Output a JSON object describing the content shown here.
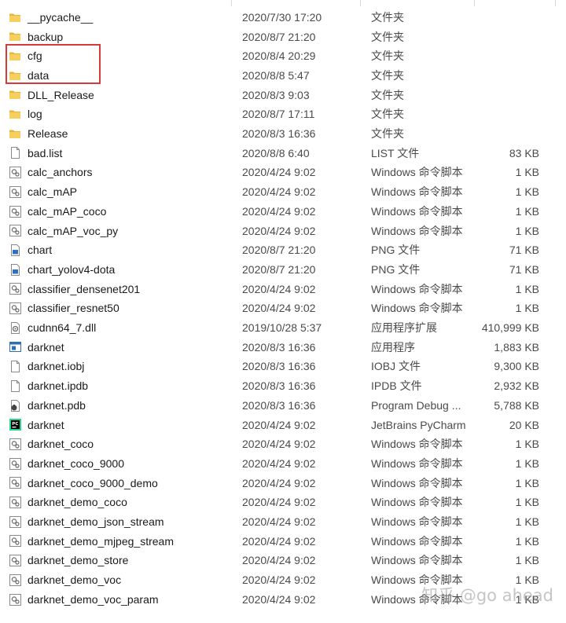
{
  "files": [
    {
      "name": "__pycache__",
      "date": "2020/7/30 17:20",
      "type": "文件夹",
      "size": "",
      "icon": "folder-icon"
    },
    {
      "name": "backup",
      "date": "2020/8/7 21:20",
      "type": "文件夹",
      "size": "",
      "icon": "folder-icon"
    },
    {
      "name": "cfg",
      "date": "2020/8/4 20:29",
      "type": "文件夹",
      "size": "",
      "icon": "folder-icon"
    },
    {
      "name": "data",
      "date": "2020/8/8 5:47",
      "type": "文件夹",
      "size": "",
      "icon": "folder-icon"
    },
    {
      "name": "DLL_Release",
      "date": "2020/8/3 9:03",
      "type": "文件夹",
      "size": "",
      "icon": "folder-icon"
    },
    {
      "name": "log",
      "date": "2020/8/7 17:11",
      "type": "文件夹",
      "size": "",
      "icon": "folder-icon"
    },
    {
      "name": "Release",
      "date": "2020/8/3 16:36",
      "type": "文件夹",
      "size": "",
      "icon": "folder-icon"
    },
    {
      "name": "bad.list",
      "date": "2020/8/8 6:40",
      "type": "LIST 文件",
      "size": "83 KB",
      "icon": "file-icon"
    },
    {
      "name": "calc_anchors",
      "date": "2020/4/24 9:02",
      "type": "Windows 命令脚本",
      "size": "1 KB",
      "icon": "script-icon"
    },
    {
      "name": "calc_mAP",
      "date": "2020/4/24 9:02",
      "type": "Windows 命令脚本",
      "size": "1 KB",
      "icon": "script-icon"
    },
    {
      "name": "calc_mAP_coco",
      "date": "2020/4/24 9:02",
      "type": "Windows 命令脚本",
      "size": "1 KB",
      "icon": "script-icon"
    },
    {
      "name": "calc_mAP_voc_py",
      "date": "2020/4/24 9:02",
      "type": "Windows 命令脚本",
      "size": "1 KB",
      "icon": "script-icon"
    },
    {
      "name": "chart",
      "date": "2020/8/7 21:20",
      "type": "PNG 文件",
      "size": "71 KB",
      "icon": "image-icon"
    },
    {
      "name": "chart_yolov4-dota",
      "date": "2020/8/7 21:20",
      "type": "PNG 文件",
      "size": "71 KB",
      "icon": "image-icon"
    },
    {
      "name": "classifier_densenet201",
      "date": "2020/4/24 9:02",
      "type": "Windows 命令脚本",
      "size": "1 KB",
      "icon": "script-icon"
    },
    {
      "name": "classifier_resnet50",
      "date": "2020/4/24 9:02",
      "type": "Windows 命令脚本",
      "size": "1 KB",
      "icon": "script-icon"
    },
    {
      "name": "cudnn64_7.dll",
      "date": "2019/10/28 5:37",
      "type": "应用程序扩展",
      "size": "410,999 KB",
      "icon": "dll-icon"
    },
    {
      "name": "darknet",
      "date": "2020/8/3 16:36",
      "type": "应用程序",
      "size": "1,883 KB",
      "icon": "exe-icon"
    },
    {
      "name": "darknet.iobj",
      "date": "2020/8/3 16:36",
      "type": "IOBJ 文件",
      "size": "9,300 KB",
      "icon": "file-icon"
    },
    {
      "name": "darknet.ipdb",
      "date": "2020/8/3 16:36",
      "type": "IPDB 文件",
      "size": "2,932 KB",
      "icon": "file-icon"
    },
    {
      "name": "darknet.pdb",
      "date": "2020/8/3 16:36",
      "type": "Program Debug ...",
      "size": "5,788 KB",
      "icon": "pdb-icon"
    },
    {
      "name": "darknet",
      "date": "2020/4/24 9:02",
      "type": "JetBrains PyCharm",
      "size": "20 KB",
      "icon": "pycharm-icon"
    },
    {
      "name": "darknet_coco",
      "date": "2020/4/24 9:02",
      "type": "Windows 命令脚本",
      "size": "1 KB",
      "icon": "script-icon"
    },
    {
      "name": "darknet_coco_9000",
      "date": "2020/4/24 9:02",
      "type": "Windows 命令脚本",
      "size": "1 KB",
      "icon": "script-icon"
    },
    {
      "name": "darknet_coco_9000_demo",
      "date": "2020/4/24 9:02",
      "type": "Windows 命令脚本",
      "size": "1 KB",
      "icon": "script-icon"
    },
    {
      "name": "darknet_demo_coco",
      "date": "2020/4/24 9:02",
      "type": "Windows 命令脚本",
      "size": "1 KB",
      "icon": "script-icon"
    },
    {
      "name": "darknet_demo_json_stream",
      "date": "2020/4/24 9:02",
      "type": "Windows 命令脚本",
      "size": "1 KB",
      "icon": "script-icon"
    },
    {
      "name": "darknet_demo_mjpeg_stream",
      "date": "2020/4/24 9:02",
      "type": "Windows 命令脚本",
      "size": "1 KB",
      "icon": "script-icon"
    },
    {
      "name": "darknet_demo_store",
      "date": "2020/4/24 9:02",
      "type": "Windows 命令脚本",
      "size": "1 KB",
      "icon": "script-icon"
    },
    {
      "name": "darknet_demo_voc",
      "date": "2020/4/24 9:02",
      "type": "Windows 命令脚本",
      "size": "1 KB",
      "icon": "script-icon"
    },
    {
      "name": "darknet_demo_voc_param",
      "date": "2020/4/24 9:02",
      "type": "Windows 命令脚本",
      "size": "1 KB",
      "icon": "script-icon"
    }
  ],
  "watermark": "知乎 @go ahead",
  "colors": {
    "highlight": "#d63b3b",
    "folder": "#f2c14e",
    "text": "#1a1a1a",
    "muted": "#4a4a4a"
  }
}
